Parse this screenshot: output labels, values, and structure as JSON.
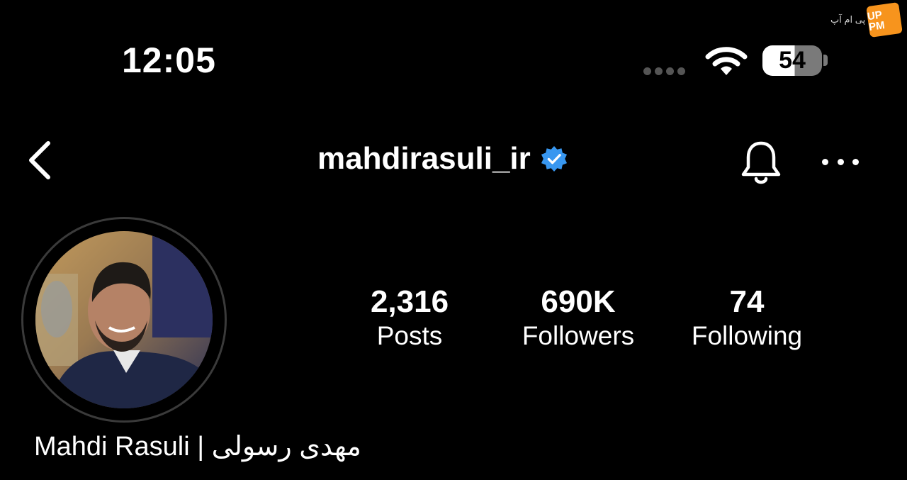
{
  "status_bar": {
    "time": "12:05",
    "battery": "54"
  },
  "watermark": {
    "text": "پی ام آپ",
    "logo_text": "UP PM"
  },
  "header": {
    "username": "mahdirasuli_ir",
    "verified": true,
    "verified_color": "#3897f0",
    "back_icon": "chevron-left-icon",
    "bell_icon": "bell-icon",
    "more_icon": "more-horizontal-icon"
  },
  "profile": {
    "display_name": "Mahdi Rasuli | مهدی رسولی",
    "stats": {
      "posts": {
        "value": "2,316",
        "label": "Posts"
      },
      "followers": {
        "value": "690K",
        "label": "Followers"
      },
      "following": {
        "value": "74",
        "label": "Following"
      }
    }
  }
}
